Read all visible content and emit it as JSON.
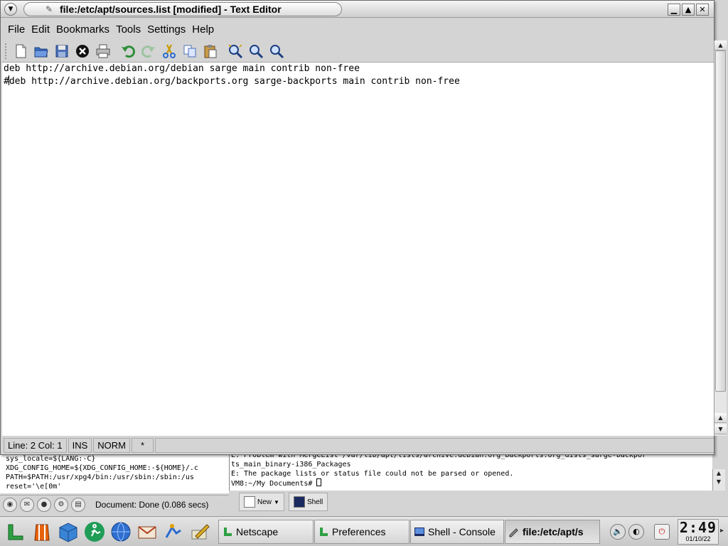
{
  "window": {
    "title": "file:/etc/apt/sources.list [modified] - Text Editor",
    "menu_icon": "chevron-down-icon",
    "buttons": {
      "minimize": "▁",
      "maximize": "▲",
      "close": "✕"
    }
  },
  "menubar": {
    "items": [
      "File",
      "Edit",
      "Bookmarks",
      "Tools",
      "Settings",
      "Help"
    ]
  },
  "toolbar": {
    "icons": [
      "new-document-icon",
      "open-folder-icon",
      "save-icon",
      "close-document-icon",
      "print-icon",
      "undo-icon",
      "redo-icon",
      "cut-icon",
      "copy-icon",
      "paste-icon",
      "find-icon",
      "find-next-icon",
      "find-previous-icon"
    ]
  },
  "editor": {
    "line1": "deb http://archive.debian.org/debian sarge main contrib non-free",
    "line2_prefix": "#",
    "line2_rest": "deb http://archive.debian.org/backports.org sarge-backports main contrib non-free"
  },
  "statusbar": {
    "position": "Line: 2 Col: 1",
    "mode": "INS",
    "insert": "NORM",
    "modified": "*"
  },
  "background": {
    "left_terminal": [
      "sys_locale=${LANG:-C}",
      "XDG_CONFIG_HOME=${XDG_CONFIG_HOME:-${HOME}/.c",
      "PATH=$PATH:/usr/xpg4/bin:/usr/sbin:/sbin:/us",
      "reset='\\e[0m'"
    ],
    "right_terminal": [
      "E: Problem with MergeList /var/lib/apt/lists/archive.debian.org_backports.org_dists_sarge-backpor",
      "ts_main_binary-i386_Packages",
      "E: The package lists or status file could not be parsed or opened.",
      "VM8:~/My Documents# "
    ],
    "browser_status": "Document: Done (0.086 secs)",
    "console_tabs": {
      "new": "New",
      "shell": "Shell"
    }
  },
  "taskbar": {
    "tasks": [
      "Netscape",
      "Preferences",
      "Shell - Console",
      "file:/etc/apt/s"
    ],
    "clock_time": "2:49",
    "clock_date": "01/10/22"
  }
}
